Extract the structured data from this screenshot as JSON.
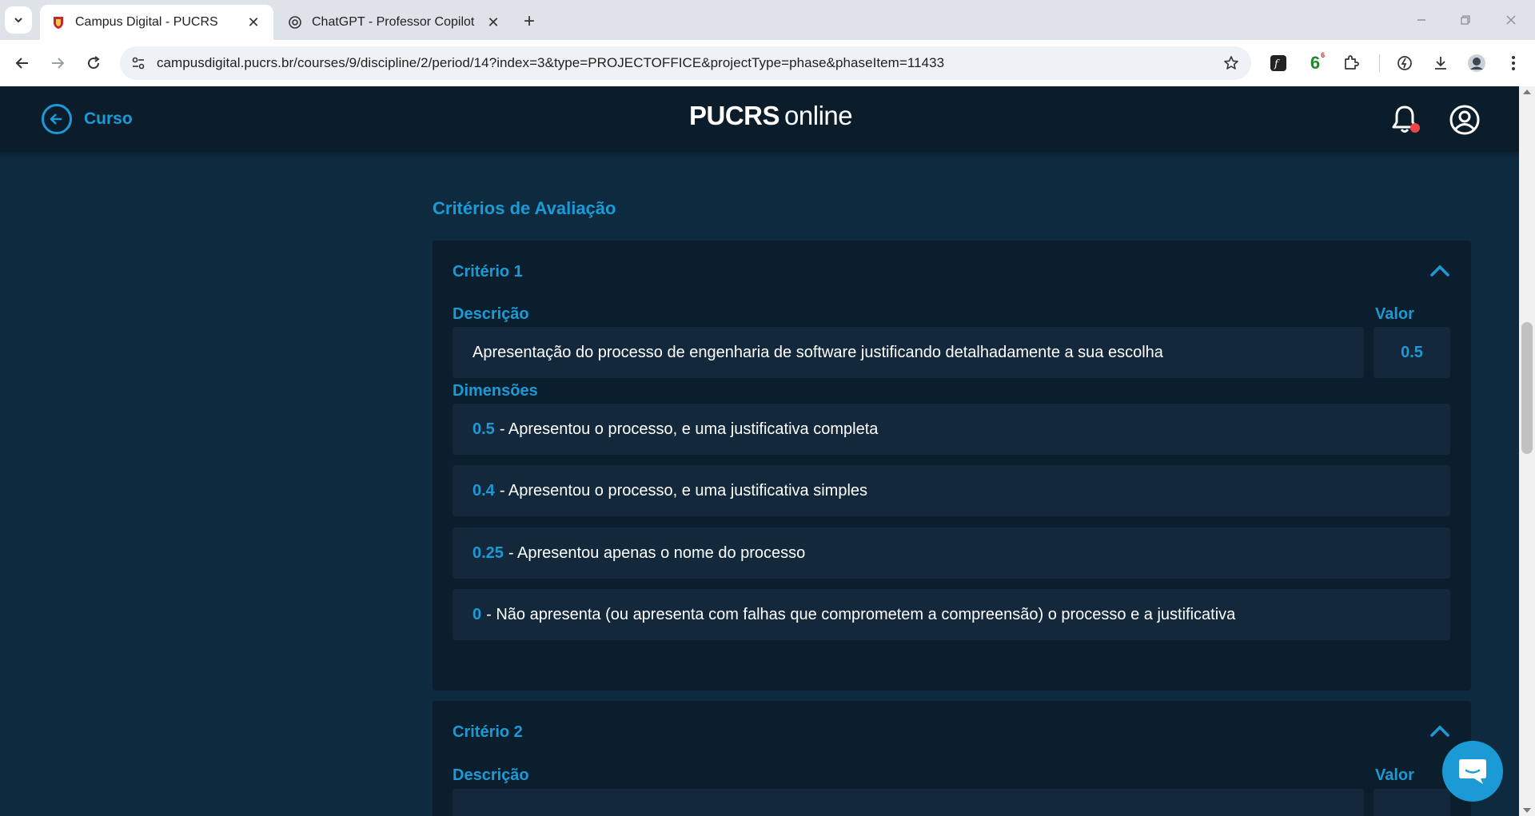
{
  "browser": {
    "tabs": [
      {
        "title": "Campus Digital - PUCRS",
        "active": true,
        "icon": "pucrs-favicon-icon"
      },
      {
        "title": "ChatGPT - Professor Copilot",
        "active": false,
        "icon": "openai-favicon-icon"
      }
    ],
    "url": "campusdigital.pucrs.br/courses/9/discipline/2/period/14?index=3&type=PROJECTOFFICE&projectType=phase&phaseItem=11433",
    "extension_badge": "6",
    "extension_badge_sup": "6"
  },
  "header": {
    "back_label": "Curso",
    "logo_bold": "PUCRS",
    "logo_light": "online",
    "notification_dot": true
  },
  "section_title": "Critérios de Avaliação",
  "criteria": [
    {
      "title": "Critério 1",
      "description_label": "Descrição",
      "value_label": "Valor",
      "description": "Apresentação do processo de engenharia de software justificando detalhadamente a sua escolha",
      "value": "0.5",
      "dimensions_label": "Dimensões",
      "dimensions": [
        {
          "value": "0.5",
          "text": "- Apresentou o processo, e uma justificativa completa"
        },
        {
          "value": "0.4",
          "text": "- Apresentou o processo, e uma justificativa simples"
        },
        {
          "value": "0.25",
          "text": "- Apresentou apenas o nome do processo"
        },
        {
          "value": "0",
          "text": "- Não apresenta (ou apresenta com falhas que comprometem a compreensão) o processo e a justificativa"
        }
      ]
    },
    {
      "title": "Critério 2",
      "description_label": "Descrição",
      "value_label": "Valor"
    }
  ],
  "colors": {
    "accent": "#1c9ad6",
    "page_bg": "#0e2a3f",
    "card_bg": "#0b1e2d",
    "row_bg": "#13293b"
  }
}
